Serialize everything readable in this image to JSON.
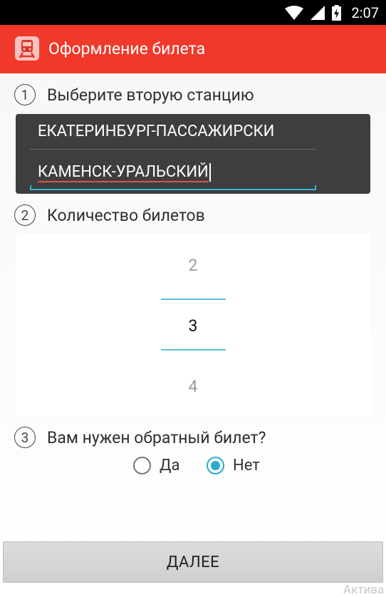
{
  "status_bar": {
    "time": "2:07"
  },
  "action_bar": {
    "title": "Оформление билета"
  },
  "step1": {
    "number": "1",
    "label": "Выберите вторую станцию"
  },
  "stations": {
    "first": "ЕКАТЕРИНБУРГ-ПАССАЖИРСКИ",
    "second": "КАМЕНСК-УРАЛЬСКИЙ"
  },
  "step2": {
    "number": "2",
    "label": "Количество билетов"
  },
  "ticket_picker": {
    "prev": "2",
    "selected": "3",
    "next": "4"
  },
  "step3": {
    "number": "3",
    "label": "Вам нужен обратный билет?"
  },
  "return_ticket": {
    "yes_label": "Да",
    "no_label": "Нет",
    "selected": "Нет"
  },
  "next_button": {
    "label": "ДАЛЕЕ"
  },
  "watermark": "Актива",
  "colors": {
    "accent": "#f0392b",
    "highlight": "#35b4d8"
  }
}
